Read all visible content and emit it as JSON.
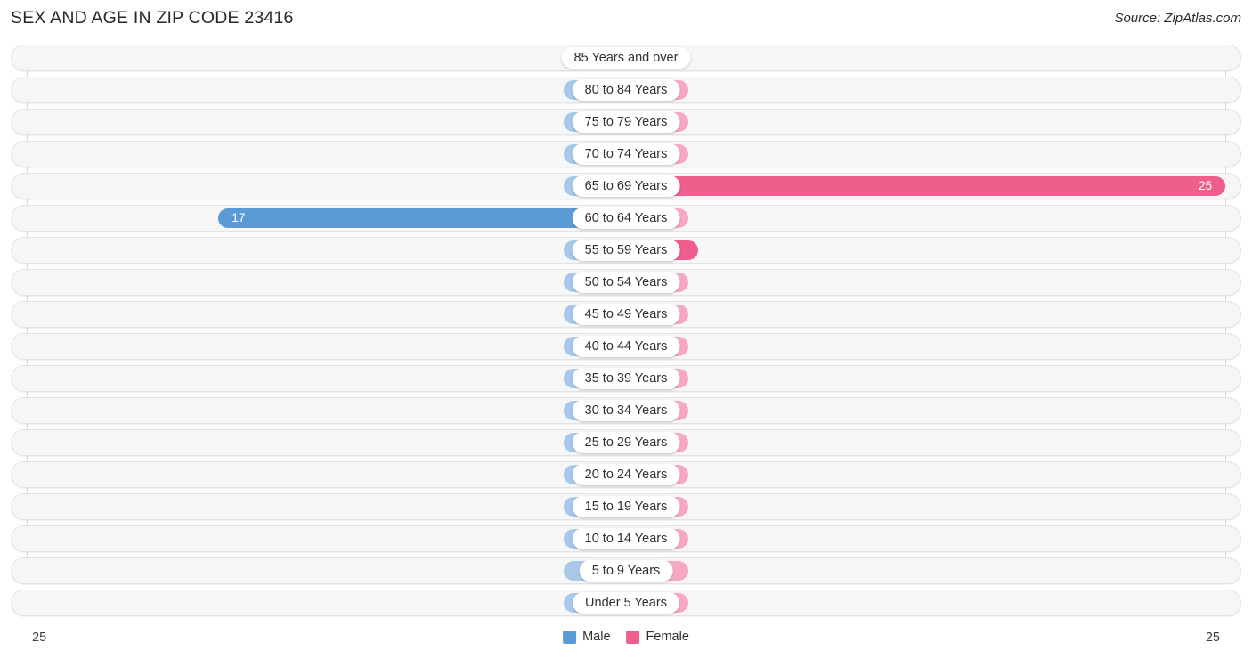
{
  "header": {
    "title": "SEX AND AGE IN ZIP CODE 23416",
    "source": "Source: ZipAtlas.com"
  },
  "footer": {
    "tick_left": "25",
    "tick_right": "25",
    "legend": [
      {
        "label": "Male",
        "color": "#5b9bd5",
        "icon": "male-swatch-icon"
      },
      {
        "label": "Female",
        "color": "#ef5f8c",
        "icon": "female-swatch-icon"
      }
    ]
  },
  "colors": {
    "male_value": "#5b9bd5",
    "male_zero": "#a8c8ea",
    "female_value": "#ef5f8c",
    "female_zero": "#f6a8c0",
    "row_bg": "#f6f6f6",
    "row_border": "#e3e3e3"
  },
  "chart_data": {
    "type": "bar",
    "subtype": "population-pyramid",
    "title": "SEX AND AGE IN ZIP CODE 23416",
    "xlabel": "",
    "ylabel": "",
    "xlim": [
      25,
      25
    ],
    "axis_max": 25,
    "grid": false,
    "legend_position": "bottom-center",
    "categories": [
      "85 Years and over",
      "80 to 84 Years",
      "75 to 79 Years",
      "70 to 74 Years",
      "65 to 69 Years",
      "60 to 64 Years",
      "55 to 59 Years",
      "50 to 54 Years",
      "45 to 49 Years",
      "40 to 44 Years",
      "35 to 39 Years",
      "30 to 34 Years",
      "25 to 29 Years",
      "20 to 24 Years",
      "15 to 19 Years",
      "10 to 14 Years",
      "5 to 9 Years",
      "Under 5 Years"
    ],
    "series": [
      {
        "name": "Male",
        "color": "#5b9bd5",
        "values": [
          0,
          0,
          0,
          0,
          0,
          17,
          0,
          0,
          0,
          0,
          0,
          0,
          0,
          0,
          0,
          0,
          0,
          0
        ]
      },
      {
        "name": "Female",
        "color": "#ef5f8c",
        "values": [
          0,
          0,
          0,
          0,
          25,
          0,
          3,
          0,
          0,
          0,
          0,
          0,
          0,
          0,
          0,
          0,
          0,
          0
        ]
      }
    ]
  }
}
